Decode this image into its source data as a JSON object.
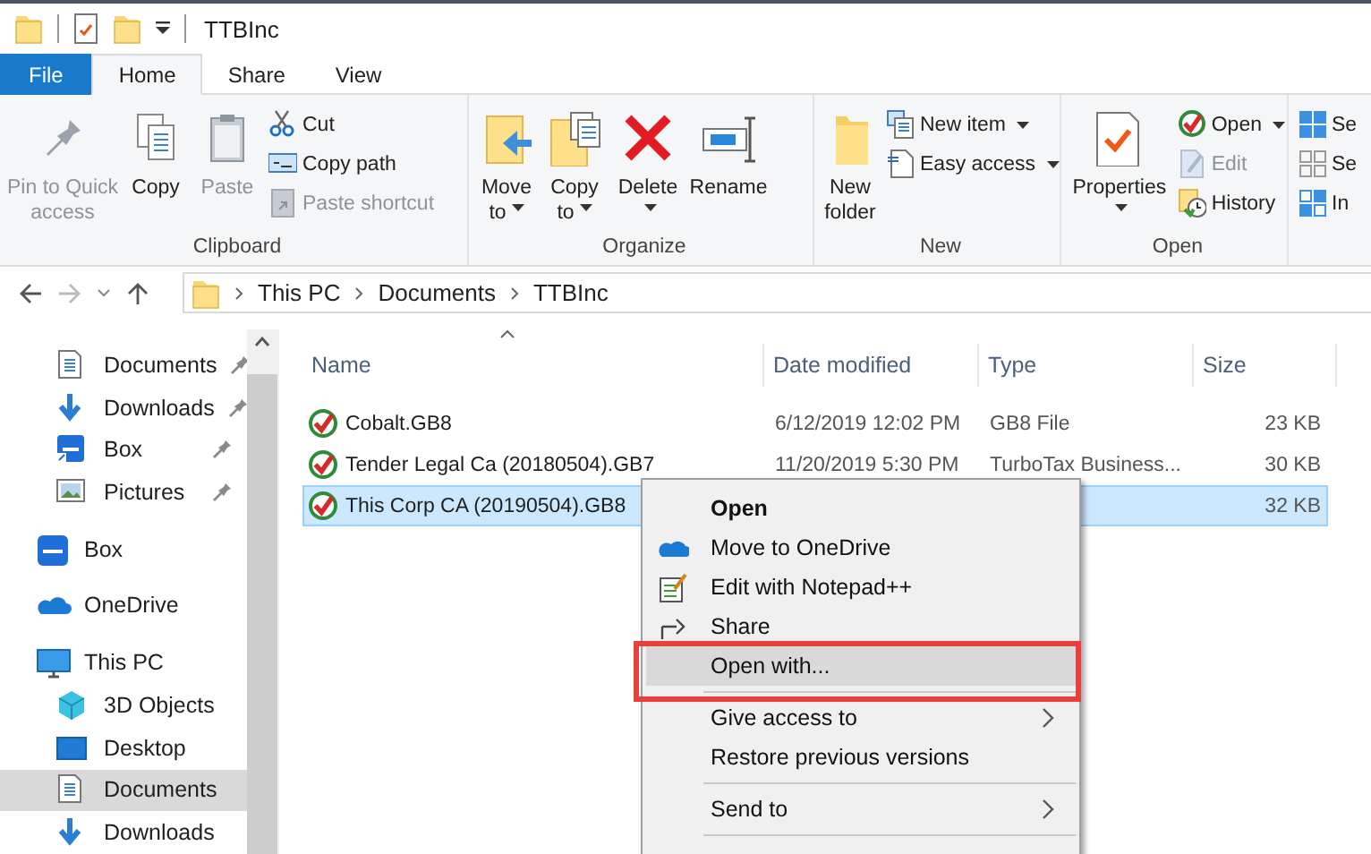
{
  "window": {
    "title": "TTBInc"
  },
  "ribbon": {
    "tabs": [
      {
        "label": "File",
        "kind": "file",
        "selected": false
      },
      {
        "label": "Home",
        "kind": "tab",
        "selected": true
      },
      {
        "label": "Share",
        "kind": "tab",
        "selected": false
      },
      {
        "label": "View",
        "kind": "tab",
        "selected": false
      }
    ],
    "groups": [
      {
        "label": "Clipboard",
        "buttons": [
          {
            "label": "Pin to Quick access",
            "kind": "large",
            "disabled": true,
            "dropdown": false
          },
          {
            "label": "Copy",
            "kind": "large",
            "disabled": false,
            "dropdown": false
          },
          {
            "label": "Paste",
            "kind": "large",
            "disabled": true,
            "dropdown": false
          },
          {
            "label": "Cut",
            "kind": "small",
            "disabled": false,
            "dropdown": false
          },
          {
            "label": "Copy path",
            "kind": "small",
            "disabled": false,
            "dropdown": false
          },
          {
            "label": "Paste shortcut",
            "kind": "small",
            "disabled": true,
            "dropdown": false
          }
        ]
      },
      {
        "label": "Organize",
        "buttons": [
          {
            "label": "Move to",
            "kind": "large",
            "disabled": false,
            "dropdown": true
          },
          {
            "label": "Copy to",
            "kind": "large",
            "disabled": false,
            "dropdown": true
          },
          {
            "label": "Delete",
            "kind": "large",
            "disabled": false,
            "dropdown": true
          },
          {
            "label": "Rename",
            "kind": "large",
            "disabled": false,
            "dropdown": false
          }
        ]
      },
      {
        "label": "New",
        "buttons": [
          {
            "label": "New folder",
            "kind": "large",
            "disabled": false,
            "dropdown": false
          },
          {
            "label": "New item",
            "kind": "small",
            "disabled": false,
            "dropdown": true
          },
          {
            "label": "Easy access",
            "kind": "small",
            "disabled": false,
            "dropdown": true
          }
        ]
      },
      {
        "label": "Open",
        "buttons": [
          {
            "label": "Properties",
            "kind": "large",
            "disabled": false,
            "dropdown": true
          },
          {
            "label": "Open",
            "kind": "small",
            "disabled": false,
            "dropdown": true
          },
          {
            "label": "Edit",
            "kind": "small",
            "disabled": true,
            "dropdown": false
          },
          {
            "label": "History",
            "kind": "small",
            "disabled": false,
            "dropdown": false
          }
        ]
      },
      {
        "buttons": [
          {
            "label": "Se",
            "kind": "small",
            "disabled": false,
            "dropdown": false
          },
          {
            "label": "Se",
            "kind": "small",
            "disabled": false,
            "dropdown": false
          },
          {
            "label": "In",
            "kind": "small",
            "disabled": false,
            "dropdown": false
          }
        ]
      }
    ]
  },
  "address_bar": {
    "crumbs": [
      "This PC",
      "Documents",
      "TTBInc"
    ]
  },
  "navigation": {
    "quick_access": [
      {
        "label": "Documents",
        "pinned": true,
        "selected": false
      },
      {
        "label": "Downloads",
        "pinned": true,
        "selected": false
      },
      {
        "label": "Box",
        "pinned": true,
        "selected": false
      },
      {
        "label": "Pictures",
        "pinned": true,
        "selected": false
      }
    ],
    "items": [
      {
        "label": "Box",
        "selected": false
      },
      {
        "label": "OneDrive",
        "selected": false
      },
      {
        "label": "This PC",
        "selected": false,
        "children": [
          {
            "label": "3D Objects",
            "selected": false
          },
          {
            "label": "Desktop",
            "selected": false
          },
          {
            "label": "Documents",
            "selected": true
          },
          {
            "label": "Downloads",
            "selected": false
          }
        ]
      }
    ]
  },
  "file_list": {
    "columns": [
      "Name",
      "Date modified",
      "Type",
      "Size"
    ],
    "rows": [
      {
        "name": "Cobalt.GB8",
        "date_modified": "6/12/2019 12:02 PM",
        "type": "GB8 File",
        "size": "23 KB",
        "selected": false
      },
      {
        "name": "Tender Legal Ca (20180504).GB7",
        "date_modified": "11/20/2019 5:30 PM",
        "type": "TurboTax Business...",
        "size": "30 KB",
        "selected": false
      },
      {
        "name": "This Corp CA (20190504).GB8",
        "size": "32 KB",
        "selected": true
      }
    ]
  },
  "context_menu": {
    "items": [
      {
        "kind": "item",
        "label": "Open",
        "bold": true,
        "submenu": false,
        "selected": false,
        "outlined": false
      },
      {
        "kind": "item",
        "label": "Move to OneDrive",
        "bold": false,
        "submenu": false,
        "selected": false,
        "outlined": false
      },
      {
        "kind": "item",
        "label": "Edit with Notepad++",
        "bold": false,
        "submenu": false,
        "selected": false,
        "outlined": false
      },
      {
        "kind": "item",
        "label": "Share",
        "bold": false,
        "submenu": false,
        "selected": false,
        "outlined": false
      },
      {
        "kind": "item",
        "label": "Open with...",
        "bold": false,
        "submenu": false,
        "selected": true,
        "outlined": true
      },
      {
        "kind": "separator"
      },
      {
        "kind": "item",
        "label": "Give access to",
        "bold": false,
        "submenu": true,
        "selected": false,
        "outlined": false
      },
      {
        "kind": "item",
        "label": "Restore previous versions",
        "bold": false,
        "submenu": false,
        "selected": false,
        "outlined": false
      },
      {
        "kind": "separator"
      },
      {
        "kind": "item",
        "label": "Send to",
        "bold": false,
        "submenu": true,
        "selected": false,
        "outlined": false
      },
      {
        "kind": "separator"
      }
    ]
  }
}
